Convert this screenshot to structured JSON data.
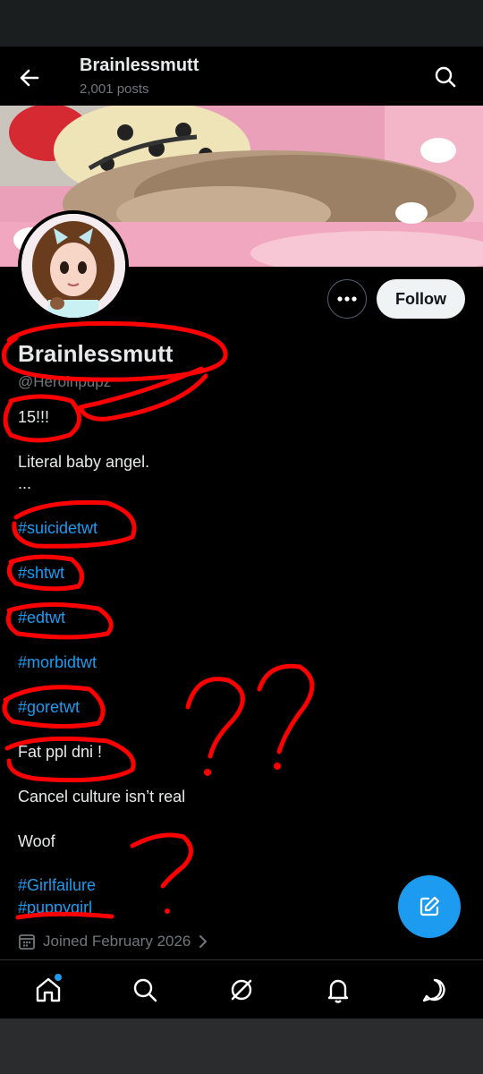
{
  "header": {
    "title": "Brainlessmutt",
    "posts": "2,001 posts",
    "back_icon": "arrow-left-icon",
    "search_icon": "search-icon"
  },
  "profile": {
    "display_name": "Brainlessmutt",
    "handle": "@Heroinpupz",
    "follow_label": "Follow",
    "more_icon": "more-icon",
    "bio": [
      {
        "text": "15!!!",
        "is_tag": false
      },
      {
        "text": "Literal baby angel.",
        "is_tag": false
      },
      {
        "text": "...",
        "is_tag": false
      },
      {
        "text": "#suicidetwt",
        "is_tag": true
      },
      {
        "text": "#shtwt",
        "is_tag": true
      },
      {
        "text": "#edtwt",
        "is_tag": true
      },
      {
        "text": "#morbidtwt",
        "is_tag": true
      },
      {
        "text": "#goretwt",
        "is_tag": true
      },
      {
        "text": "Fat ppl dni !",
        "is_tag": false
      },
      {
        "text": "Cancel culture isn’t real",
        "is_tag": false
      },
      {
        "text": "Woof",
        "is_tag": false
      },
      {
        "text": "#Girlfailure",
        "is_tag": true
      },
      {
        "text": "#puppygirl",
        "is_tag": true
      }
    ],
    "joined": "Joined February 2026"
  },
  "nav": {
    "items": [
      "home-icon",
      "search-icon",
      "grok-icon",
      "notifications-icon",
      "messages-icon"
    ]
  },
  "colors": {
    "accent": "#1d9bf0",
    "annotation": "#ff0000"
  }
}
